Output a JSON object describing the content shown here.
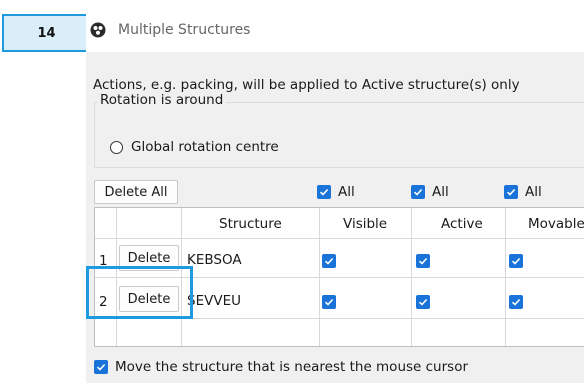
{
  "step": "14",
  "window": {
    "title": "Multiple Structures",
    "icon": "molecule-icon"
  },
  "note": "Actions, e.g. packing, will be applied to Active structure(s) only",
  "rotation": {
    "legend": "Rotation is around",
    "option_label": "Global rotation centre",
    "selected": false
  },
  "toolbar": {
    "delete_all_label": "Delete All",
    "visible_all": {
      "label": "All",
      "checked": true
    },
    "active_all": {
      "label": "All",
      "checked": true
    },
    "movable_all": {
      "label": "All",
      "checked": true
    }
  },
  "table": {
    "columns": [
      "Structure",
      "Visible",
      "Active",
      "Movable"
    ],
    "rows": [
      {
        "index": "1",
        "delete_label": "Delete",
        "structure": "KEBSOA",
        "visible": true,
        "active": true,
        "movable": true
      },
      {
        "index": "2",
        "delete_label": "Delete",
        "structure": "SEVVEU",
        "visible": true,
        "active": true,
        "movable": true
      }
    ]
  },
  "footer": {
    "label": "Move the structure that is nearest the mouse cursor",
    "checked": true
  },
  "colors": {
    "accent": "#1a73d8",
    "highlight": "#1e9ae0"
  }
}
